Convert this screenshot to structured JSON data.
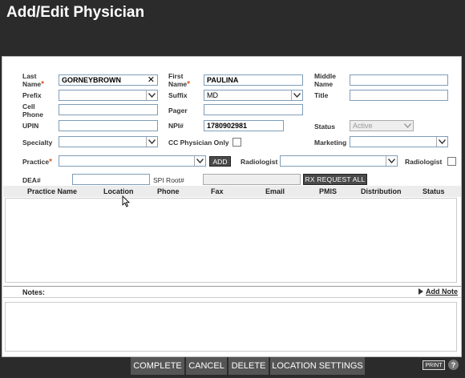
{
  "window": {
    "title": "Add/Edit Physician"
  },
  "form": {
    "last_name_label": "Last Name",
    "last_name_value": "GORNEYBROWN",
    "first_name_label": "First Name",
    "first_name_value": "PAULINA",
    "middle_name_label": "Middle Name",
    "middle_name_value": "",
    "prefix_label": "Prefix",
    "prefix_value": "",
    "suffix_label": "Suffix",
    "suffix_value": "MD",
    "title_label": "Title",
    "title_value": "",
    "cell_phone_label": "Cell Phone",
    "cell_phone_value": "",
    "pager_label": "Pager",
    "pager_value": "",
    "upin_label": "UPIN",
    "upin_value": "",
    "npi_label": "NPI#",
    "npi_value": "1780902981",
    "status_label": "Status",
    "status_value": "Active",
    "specialty_label": "Specialty",
    "specialty_value": "",
    "cc_physician_label": "CC Physician Only",
    "marketing_label": "Marketing",
    "marketing_value": "",
    "practice_label": "Practice",
    "practice_value": "",
    "add_label": "ADD",
    "radiologist_label": "Radiologist",
    "radiologist_value": "",
    "radiologist_chk_label": "Radiologist",
    "dea_label": "DEA#",
    "dea_value": "",
    "spi_label": "SPI Root#",
    "spi_value": "",
    "rx_request_label": "RX REQUEST ALL",
    "required_mark": "*"
  },
  "grid": {
    "columns": [
      "Practice Name",
      "Location",
      "Phone",
      "Fax",
      "Email",
      "PMIS",
      "Distribution",
      "Status"
    ],
    "rows": []
  },
  "notes": {
    "label": "Notes:",
    "add_note_label": "Add Note"
  },
  "footer": {
    "complete_label": "COMPLETE",
    "cancel_label": "CANCEL",
    "delete_label": "DELETE",
    "location_settings_label": "LOCATION SETTINGS",
    "print_label": "PRINT",
    "help_label": "?"
  },
  "colors": {
    "required": "#d55a1c",
    "header_bg": "#2b2b2b",
    "button_bg": "#555555"
  },
  "icons": [
    "clear-x-icon",
    "dropdown-arrow-icon",
    "add-note-arrow-icon",
    "help-icon",
    "mouse-cursor-icon"
  ]
}
